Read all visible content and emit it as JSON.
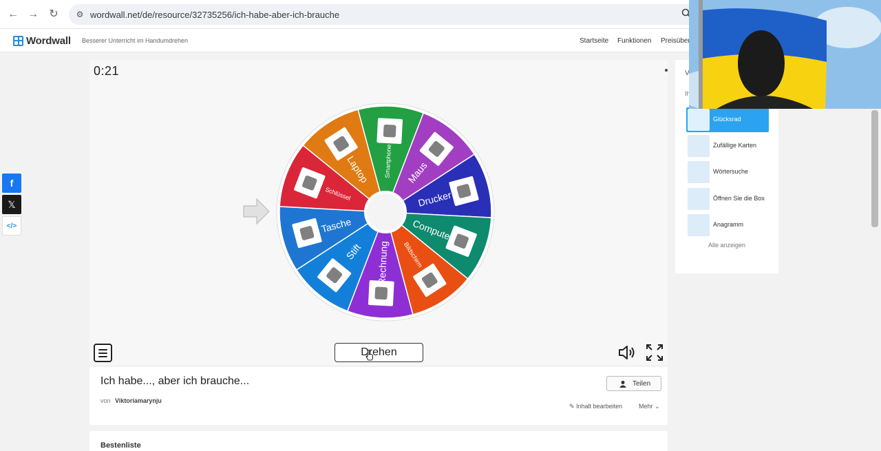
{
  "browser": {
    "url": "wordwall.net/de/resource/32735256/ich-habe-aber-ich-brauche"
  },
  "header": {
    "logo": "Wordwall",
    "tagline": "Besserer Unterricht im Handumdrehen",
    "nav": [
      "Startseite",
      "Funktionen",
      "Preisüber"
    ]
  },
  "game": {
    "timer": "0:21",
    "spin_label": "Drehen",
    "wheel_segments": [
      {
        "label": "Smartphone",
        "color": "#22a043",
        "icon": "smartphone-card-icon"
      },
      {
        "label": "Maus",
        "color": "#a23ec2",
        "icon": "mouse-card-icon"
      },
      {
        "label": "Drucker",
        "color": "#2a2fb8",
        "icon": "printer-card-icon"
      },
      {
        "label": "Computer",
        "color": "#0e8a6e",
        "icon": "computer-card-icon"
      },
      {
        "label": "Bildschirm",
        "color": "#e94f13",
        "icon": "monitor-card-icon"
      },
      {
        "label": "Rechnung",
        "color": "#8e2fd6",
        "icon": "invoice-card-icon"
      },
      {
        "label": "Stift",
        "color": "#1280d8",
        "icon": "pen-card-icon"
      },
      {
        "label": "Tasche",
        "color": "#1e76d2",
        "icon": "bag-card-icon"
      },
      {
        "label": "Schlüssel",
        "color": "#da2638",
        "icon": "key-card-icon"
      },
      {
        "label": "Laptop",
        "color": "#e07a12",
        "icon": "laptop-card-icon"
      }
    ]
  },
  "activity": {
    "title": "Ich habe..., aber ich brauche...",
    "by_label": "von",
    "author": "Viktoriamarynju",
    "share_label": "Teilen",
    "edit_label": "Inhalt bearbeiten",
    "more_label": "Mehr"
  },
  "leaderboard": {
    "title": "Bestenliste"
  },
  "sidebar": {
    "heading": "V",
    "subheading": "Ih",
    "templates": [
      {
        "label": "Glücksrad",
        "active": true
      },
      {
        "label": "Zufällige Karten",
        "active": false
      },
      {
        "label": "Wörtersuche",
        "active": false
      },
      {
        "label": "Öffnen Sie die Box",
        "active": false
      },
      {
        "label": "Anagramm",
        "active": false
      }
    ],
    "show_all": "Alle anzeigen"
  },
  "colors": {
    "accent": "#2ba3f0",
    "facebook": "#1877f2",
    "x": "#1a1a1a"
  }
}
